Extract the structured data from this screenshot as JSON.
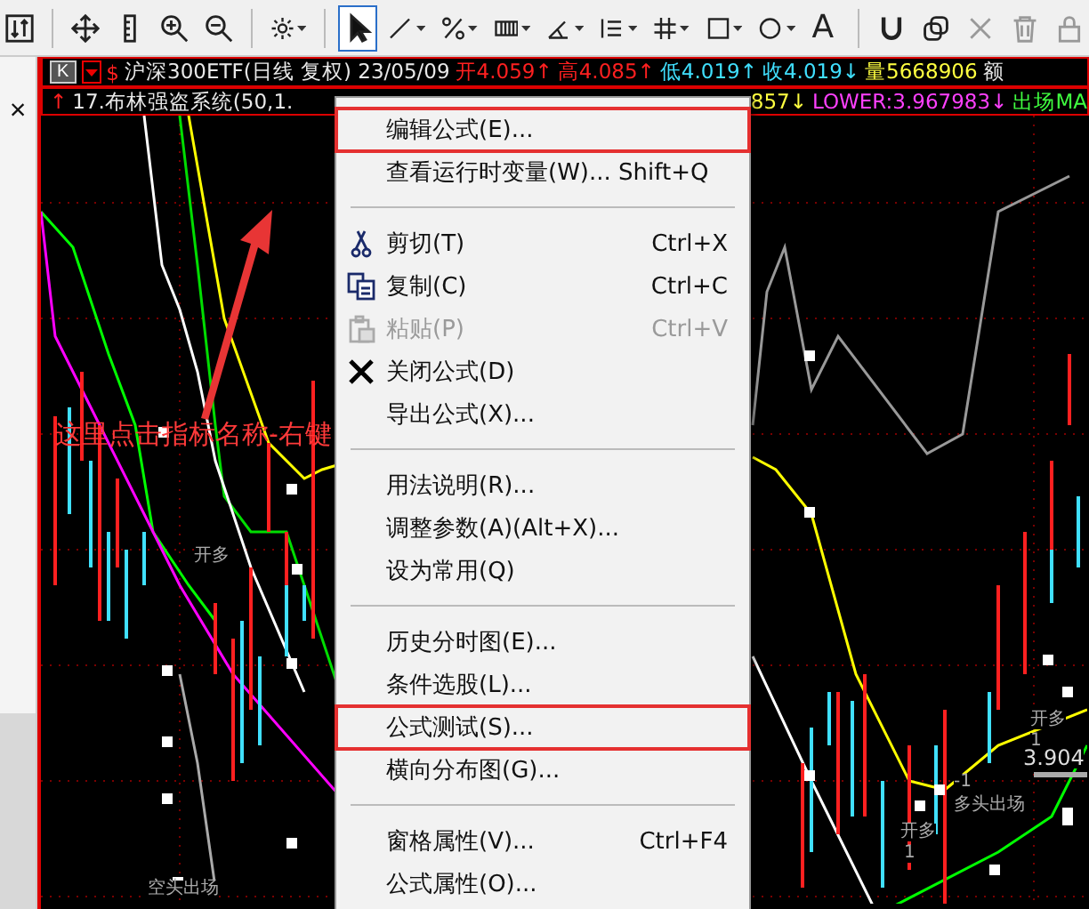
{
  "toolbar": {
    "buttons": [
      {
        "selected": false,
        "caret": false
      },
      {
        "selected": false,
        "caret": false
      },
      {
        "selected": false,
        "caret": false
      },
      {
        "selected": false,
        "caret": false
      },
      {
        "selected": false,
        "caret": false
      },
      {
        "selected": false,
        "caret": true
      },
      {
        "selected": true,
        "caret": false
      },
      {
        "selected": false,
        "caret": true
      },
      {
        "selected": false,
        "caret": true
      },
      {
        "selected": false,
        "caret": true
      },
      {
        "selected": false,
        "caret": true
      },
      {
        "selected": false,
        "caret": true
      },
      {
        "selected": false,
        "caret": true
      },
      {
        "selected": false,
        "caret": true
      },
      {
        "selected": false,
        "caret": true
      },
      {
        "selected": false,
        "caret": false
      },
      {
        "selected": false,
        "caret": false
      },
      {
        "selected": false,
        "caret": false
      },
      {
        "selected": false,
        "caret": false
      },
      {
        "selected": false,
        "caret": false
      }
    ],
    "text_button": "A"
  },
  "side_panel": {
    "close": "×"
  },
  "quote_row": {
    "period": "K",
    "items": [
      {
        "text": "$",
        "kind": "rise"
      },
      {
        "text": "沪深300ETF(日线 复权) 23/05/09",
        "kind": "title"
      },
      {
        "text": "开4.059↑",
        "kind": "rise"
      },
      {
        "text": "高4.085↑",
        "kind": "rise"
      },
      {
        "text": "低4.019↑",
        "kind": "fall"
      },
      {
        "text": "收4.019↓",
        "kind": "fall"
      },
      {
        "text": "量5668906",
        "kind": "volume"
      },
      {
        "text": "额",
        "kind": "title"
      }
    ]
  },
  "indicator_row": {
    "left": [
      {
        "text": "↑",
        "kind": "rise"
      },
      {
        "text": "17.布林强盗系统(50,1.",
        "kind": "title"
      }
    ],
    "right": [
      {
        "text": "857↓",
        "kind": "volume"
      },
      {
        "text": "LOWER:3.967983↓",
        "kind": "lower"
      },
      {
        "text": "出场MA",
        "kind": "exit"
      }
    ]
  },
  "chart_labels": [
    {
      "text": "开多"
    },
    {
      "text": "空头出场"
    },
    {
      "text": "-1"
    },
    {
      "text": "多头出场"
    },
    {
      "text": "开多"
    },
    {
      "text": "1"
    },
    {
      "text": "开多"
    },
    {
      "text": "1"
    },
    {
      "text": "3.904"
    }
  ],
  "annotation": {
    "text": "这里点击指标名称-右键"
  },
  "context_menu": [
    {
      "kind": "item",
      "label": "编辑公式(E)...",
      "disabled": false,
      "highlighted": true
    },
    {
      "kind": "item",
      "label": "查看运行时变量(W)... Shift+Q",
      "disabled": false,
      "highlighted": false
    },
    {
      "kind": "separator"
    },
    {
      "kind": "item",
      "label": "剪切(T)",
      "shortcut": "Ctrl+X",
      "disabled": false,
      "highlighted": false
    },
    {
      "kind": "item",
      "label": "复制(C)",
      "shortcut": "Ctrl+C",
      "disabled": false,
      "highlighted": false
    },
    {
      "kind": "item",
      "label": "粘贴(P)",
      "shortcut": "Ctrl+V",
      "disabled": true,
      "highlighted": false
    },
    {
      "kind": "item",
      "label": "关闭公式(D)",
      "disabled": false,
      "highlighted": false
    },
    {
      "kind": "item",
      "label": "导出公式(X)...",
      "disabled": false,
      "highlighted": false
    },
    {
      "kind": "separator"
    },
    {
      "kind": "item",
      "label": "用法说明(R)...",
      "disabled": false,
      "highlighted": false
    },
    {
      "kind": "item",
      "label": "调整参数(A)(Alt+X)...",
      "disabled": false,
      "highlighted": false
    },
    {
      "kind": "item",
      "label": "设为常用(Q)",
      "disabled": false,
      "highlighted": false
    },
    {
      "kind": "separator"
    },
    {
      "kind": "item",
      "label": "历史分时图(E)...",
      "disabled": false,
      "highlighted": false
    },
    {
      "kind": "item",
      "label": "条件选股(L)...",
      "disabled": false,
      "highlighted": false
    },
    {
      "kind": "item",
      "label": "公式测试(S)...",
      "disabled": false,
      "highlighted": true
    },
    {
      "kind": "item",
      "label": "横向分布图(G)...",
      "disabled": false,
      "highlighted": false
    },
    {
      "kind": "separator"
    },
    {
      "kind": "item",
      "label": "窗格属性(V)...",
      "shortcut": "Ctrl+F4",
      "disabled": false,
      "highlighted": false
    },
    {
      "kind": "item",
      "label": "公式属性(O)...",
      "disabled": false,
      "highlighted": false
    }
  ]
}
